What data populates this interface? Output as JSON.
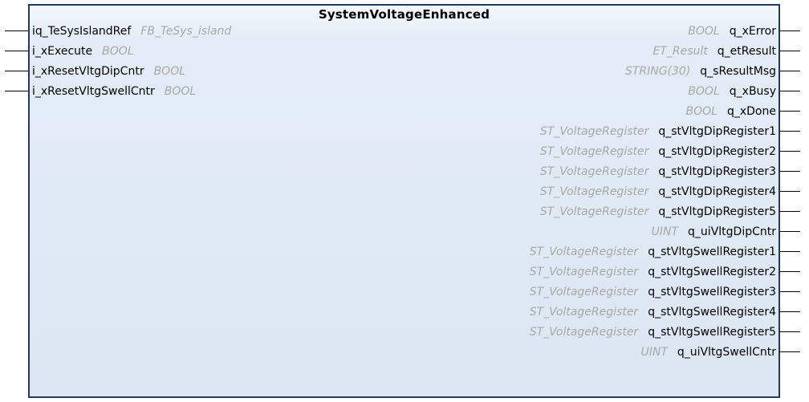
{
  "block": {
    "title": "SystemVoltageEnhanced",
    "inputs": [
      {
        "name": "iq_TeSysIslandRef",
        "type": "FB_TeSys_island"
      },
      {
        "name": "i_xExecute",
        "type": "BOOL"
      },
      {
        "name": "i_xResetVltgDipCntr",
        "type": "BOOL"
      },
      {
        "name": "i_xResetVltgSwellCntr",
        "type": "BOOL"
      }
    ],
    "outputs": [
      {
        "name": "q_xError",
        "type": "BOOL"
      },
      {
        "name": "q_etResult",
        "type": "ET_Result"
      },
      {
        "name": "q_sResultMsg",
        "type": "STRING(30)"
      },
      {
        "name": "q_xBusy",
        "type": "BOOL"
      },
      {
        "name": "q_xDone",
        "type": "BOOL"
      },
      {
        "name": "q_stVltgDipRegister1",
        "type": "ST_VoltageRegister"
      },
      {
        "name": "q_stVltgDipRegister2",
        "type": "ST_VoltageRegister"
      },
      {
        "name": "q_stVltgDipRegister3",
        "type": "ST_VoltageRegister"
      },
      {
        "name": "q_stVltgDipRegister4",
        "type": "ST_VoltageRegister"
      },
      {
        "name": "q_stVltgDipRegister5",
        "type": "ST_VoltageRegister"
      },
      {
        "name": "q_uiVltgDipCntr",
        "type": "UINT"
      },
      {
        "name": "q_stVltgSwellRegister1",
        "type": "ST_VoltageRegister"
      },
      {
        "name": "q_stVltgSwellRegister2",
        "type": "ST_VoltageRegister"
      },
      {
        "name": "q_stVltgSwellRegister3",
        "type": "ST_VoltageRegister"
      },
      {
        "name": "q_stVltgSwellRegister4",
        "type": "ST_VoltageRegister"
      },
      {
        "name": "q_stVltgSwellRegister5",
        "type": "ST_VoltageRegister"
      },
      {
        "name": "q_uiVltgSwellCntr",
        "type": "UINT"
      }
    ]
  }
}
